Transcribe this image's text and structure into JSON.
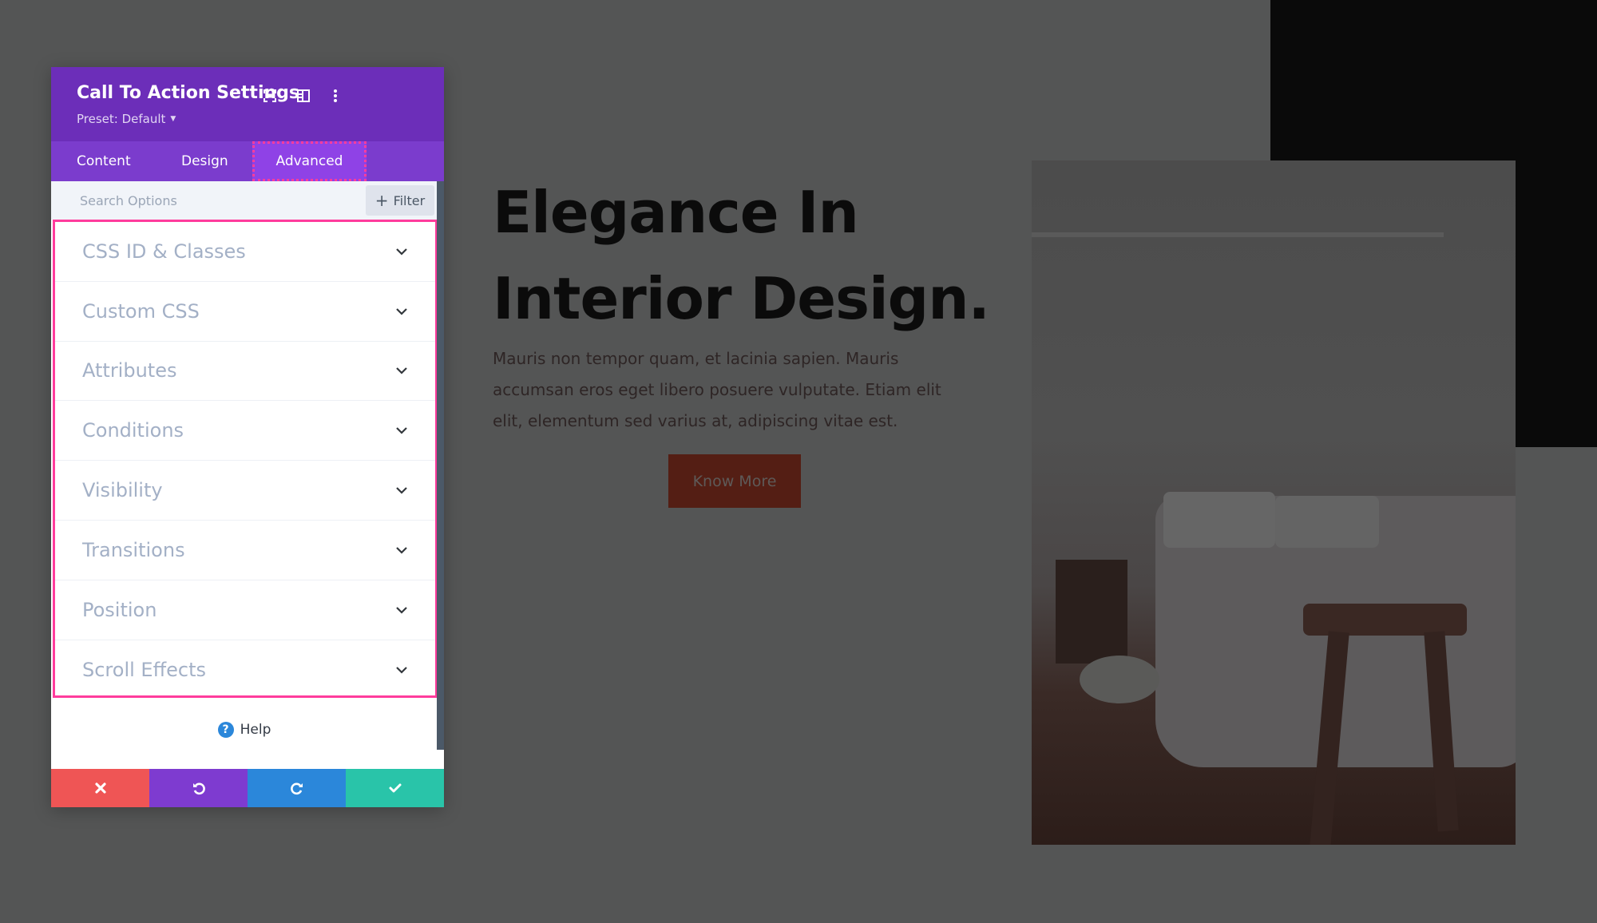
{
  "modal": {
    "title": "Call To Action Settings",
    "preset_label": "Preset: Default",
    "header_icons": [
      "fullscreen-icon",
      "split-view-icon",
      "more-options-icon"
    ],
    "tabs": [
      {
        "label": "Content",
        "active": false
      },
      {
        "label": "Design",
        "active": false
      },
      {
        "label": "Advanced",
        "active": true
      }
    ],
    "search": {
      "placeholder": "Search Options",
      "value": ""
    },
    "filter_label": "Filter",
    "groups": [
      {
        "label": "CSS ID & Classes"
      },
      {
        "label": "Custom CSS"
      },
      {
        "label": "Attributes"
      },
      {
        "label": "Conditions"
      },
      {
        "label": "Visibility"
      },
      {
        "label": "Transitions"
      },
      {
        "label": "Position"
      },
      {
        "label": "Scroll Effects"
      }
    ],
    "help_label": "Help",
    "footer_buttons": [
      {
        "name": "discard",
        "icon": "close-icon",
        "color": "#ef5555"
      },
      {
        "name": "undo",
        "icon": "undo-icon",
        "color": "#7e3bd0"
      },
      {
        "name": "redo",
        "icon": "redo-icon",
        "color": "#2b87da"
      },
      {
        "name": "save",
        "icon": "check-icon",
        "color": "#29c4a9"
      }
    ],
    "colors": {
      "header": "#6c2eb9",
      "tabs": "#7b3ccd",
      "active_tab": "#8f42e6",
      "highlight": "#ff3c9c"
    }
  },
  "page": {
    "heading_line1": "Elegance In",
    "heading_line2": "Interior Design.",
    "body_text": "Mauris non tempor quam, et lacinia sapien. Mauris accumsan eros eget libero posuere vulputate. Etiam elit elit, elementum sed varius at, adipiscing vitae est.",
    "button_label": "Know More"
  }
}
